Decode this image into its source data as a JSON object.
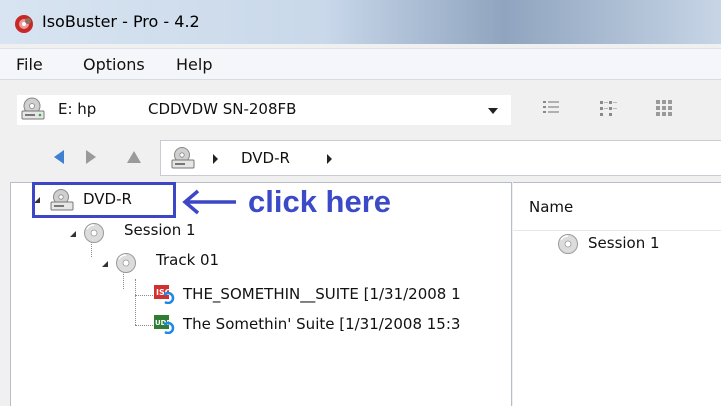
{
  "window": {
    "title": "IsoBuster - Pro - 4.2",
    "app_icon": "isobuster-icon"
  },
  "menu": {
    "items": [
      "File",
      "Options",
      "Help"
    ]
  },
  "toolbar": {
    "drive_letter": "E: hp",
    "drive_name": "CDDVDW SN-208FB",
    "drive_icon": "optical-drive-icon",
    "view_buttons": [
      "list-view-icon",
      "details-view-icon",
      "icons-view-icon"
    ]
  },
  "navigation": {
    "back_icon": "back-arrow-icon",
    "forward_icon": "forward-arrow-icon",
    "up_icon": "up-arrow-icon",
    "address": "DVD-R"
  },
  "tree": {
    "root": "DVD-R",
    "session": "Session 1",
    "track": "Track 01",
    "files": [
      "THE_SOMETHIN__SUITE [1/31/2008 1",
      "The Somethin' Suite [1/31/2008 15:3"
    ]
  },
  "list": {
    "column_name": "Name",
    "items": [
      "Session 1"
    ]
  },
  "annotation": {
    "text": "click here",
    "color": "#3b4bc8"
  }
}
